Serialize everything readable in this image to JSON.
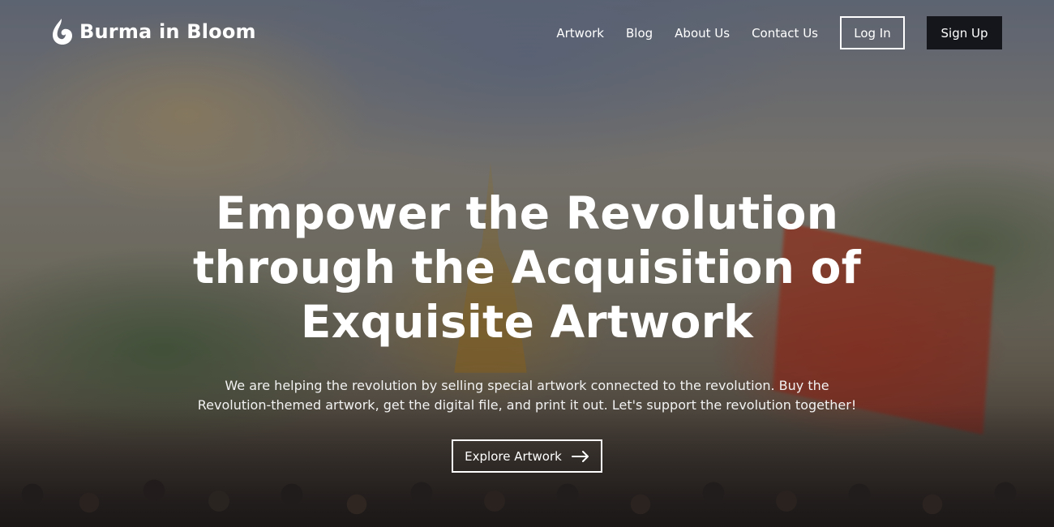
{
  "brand": {
    "name": "Burma in Bloom",
    "icon": "flame-drop-icon"
  },
  "nav": {
    "links": [
      "Artwork",
      "Blog",
      "About Us",
      "Contact Us"
    ],
    "login_label": "Log In",
    "signup_label": "Sign Up"
  },
  "hero": {
    "title": "Empower the Revolution through the Acquisition of Exquisite Artwork",
    "subtitle": "We are helping the revolution by selling special artwork connected to the revolution. Buy the Revolution-themed artwork, get the digital file, and print it out. Let's support the revolution together!",
    "cta_label": "Explore Artwork",
    "cta_icon": "arrow-right-icon"
  },
  "colors": {
    "text": "#ffffff",
    "signup_bg": "#15161c"
  }
}
